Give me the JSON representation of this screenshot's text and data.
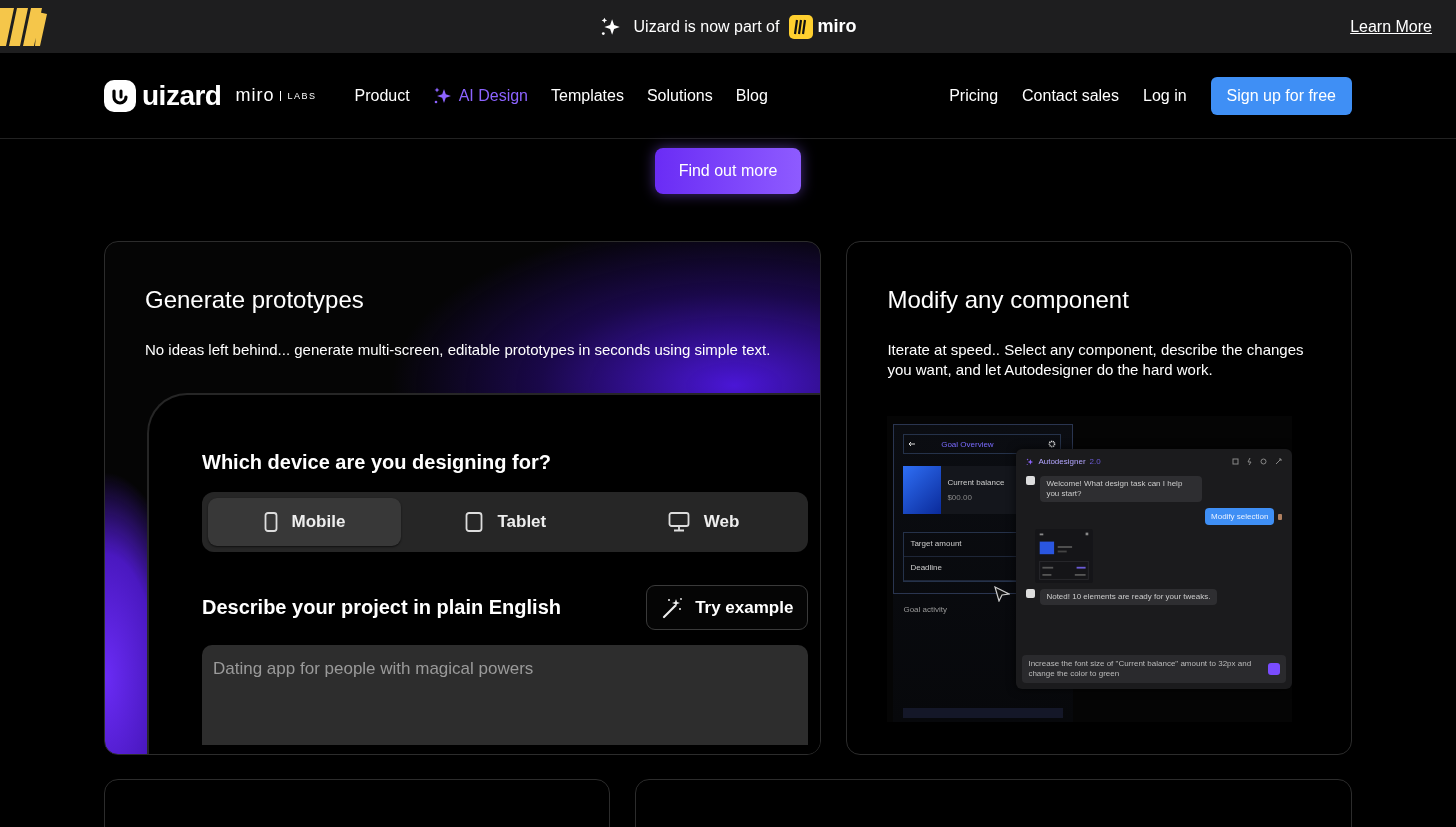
{
  "announcement": {
    "text": "Uizard is now part of",
    "brand": "miro",
    "link": "Learn More"
  },
  "nav": {
    "logo": "uizard",
    "partner": "miro",
    "partner_tag": "LABS",
    "items": [
      {
        "label": "Product",
        "kind": "plain"
      },
      {
        "label": "AI Design",
        "kind": "ai"
      },
      {
        "label": "Templates",
        "kind": "plain"
      },
      {
        "label": "Solutions",
        "kind": "plain"
      },
      {
        "label": "Blog",
        "kind": "plain"
      }
    ],
    "right_items": [
      "Pricing",
      "Contact sales",
      "Log in"
    ],
    "cta": "Sign up for free"
  },
  "hero_button": "Find out more",
  "cards": [
    {
      "kind": "prototype",
      "title": "Generate prototypes",
      "description": "No ideas left behind... generate multi-screen, editable prototypes in seconds using simple text.",
      "question": "Which device are you designing for?",
      "devices": [
        {
          "label": "Mobile",
          "selected": true
        },
        {
          "label": "Tablet",
          "selected": false
        },
        {
          "label": "Web",
          "selected": false
        }
      ],
      "prompt_label": "Describe your project in plain English",
      "try_button": "Try example",
      "placeholder": "Dating app for people with magical powers"
    },
    {
      "kind": "component",
      "title": "Modify any component",
      "description": "Iterate at speed.. Select any component, describe the changes you want, and let Autodesigner do the hard work.",
      "screen": {
        "title": "Goal Overview",
        "balance_label": "Current balance",
        "balance": "$00.00",
        "fields": [
          "Target amount",
          "Deadline"
        ],
        "section": "Goal activity"
      },
      "chat": {
        "title": "Autodesigner",
        "version": "2.0",
        "welcome": "Welcome! What design task can I help you start?",
        "user_message": "Modify selection",
        "reply": "Noted! 10 elements are ready for your tweaks.",
        "input": "Increase the font size of \"Current balance\" amount to 32px and change the color to green"
      }
    }
  ]
}
